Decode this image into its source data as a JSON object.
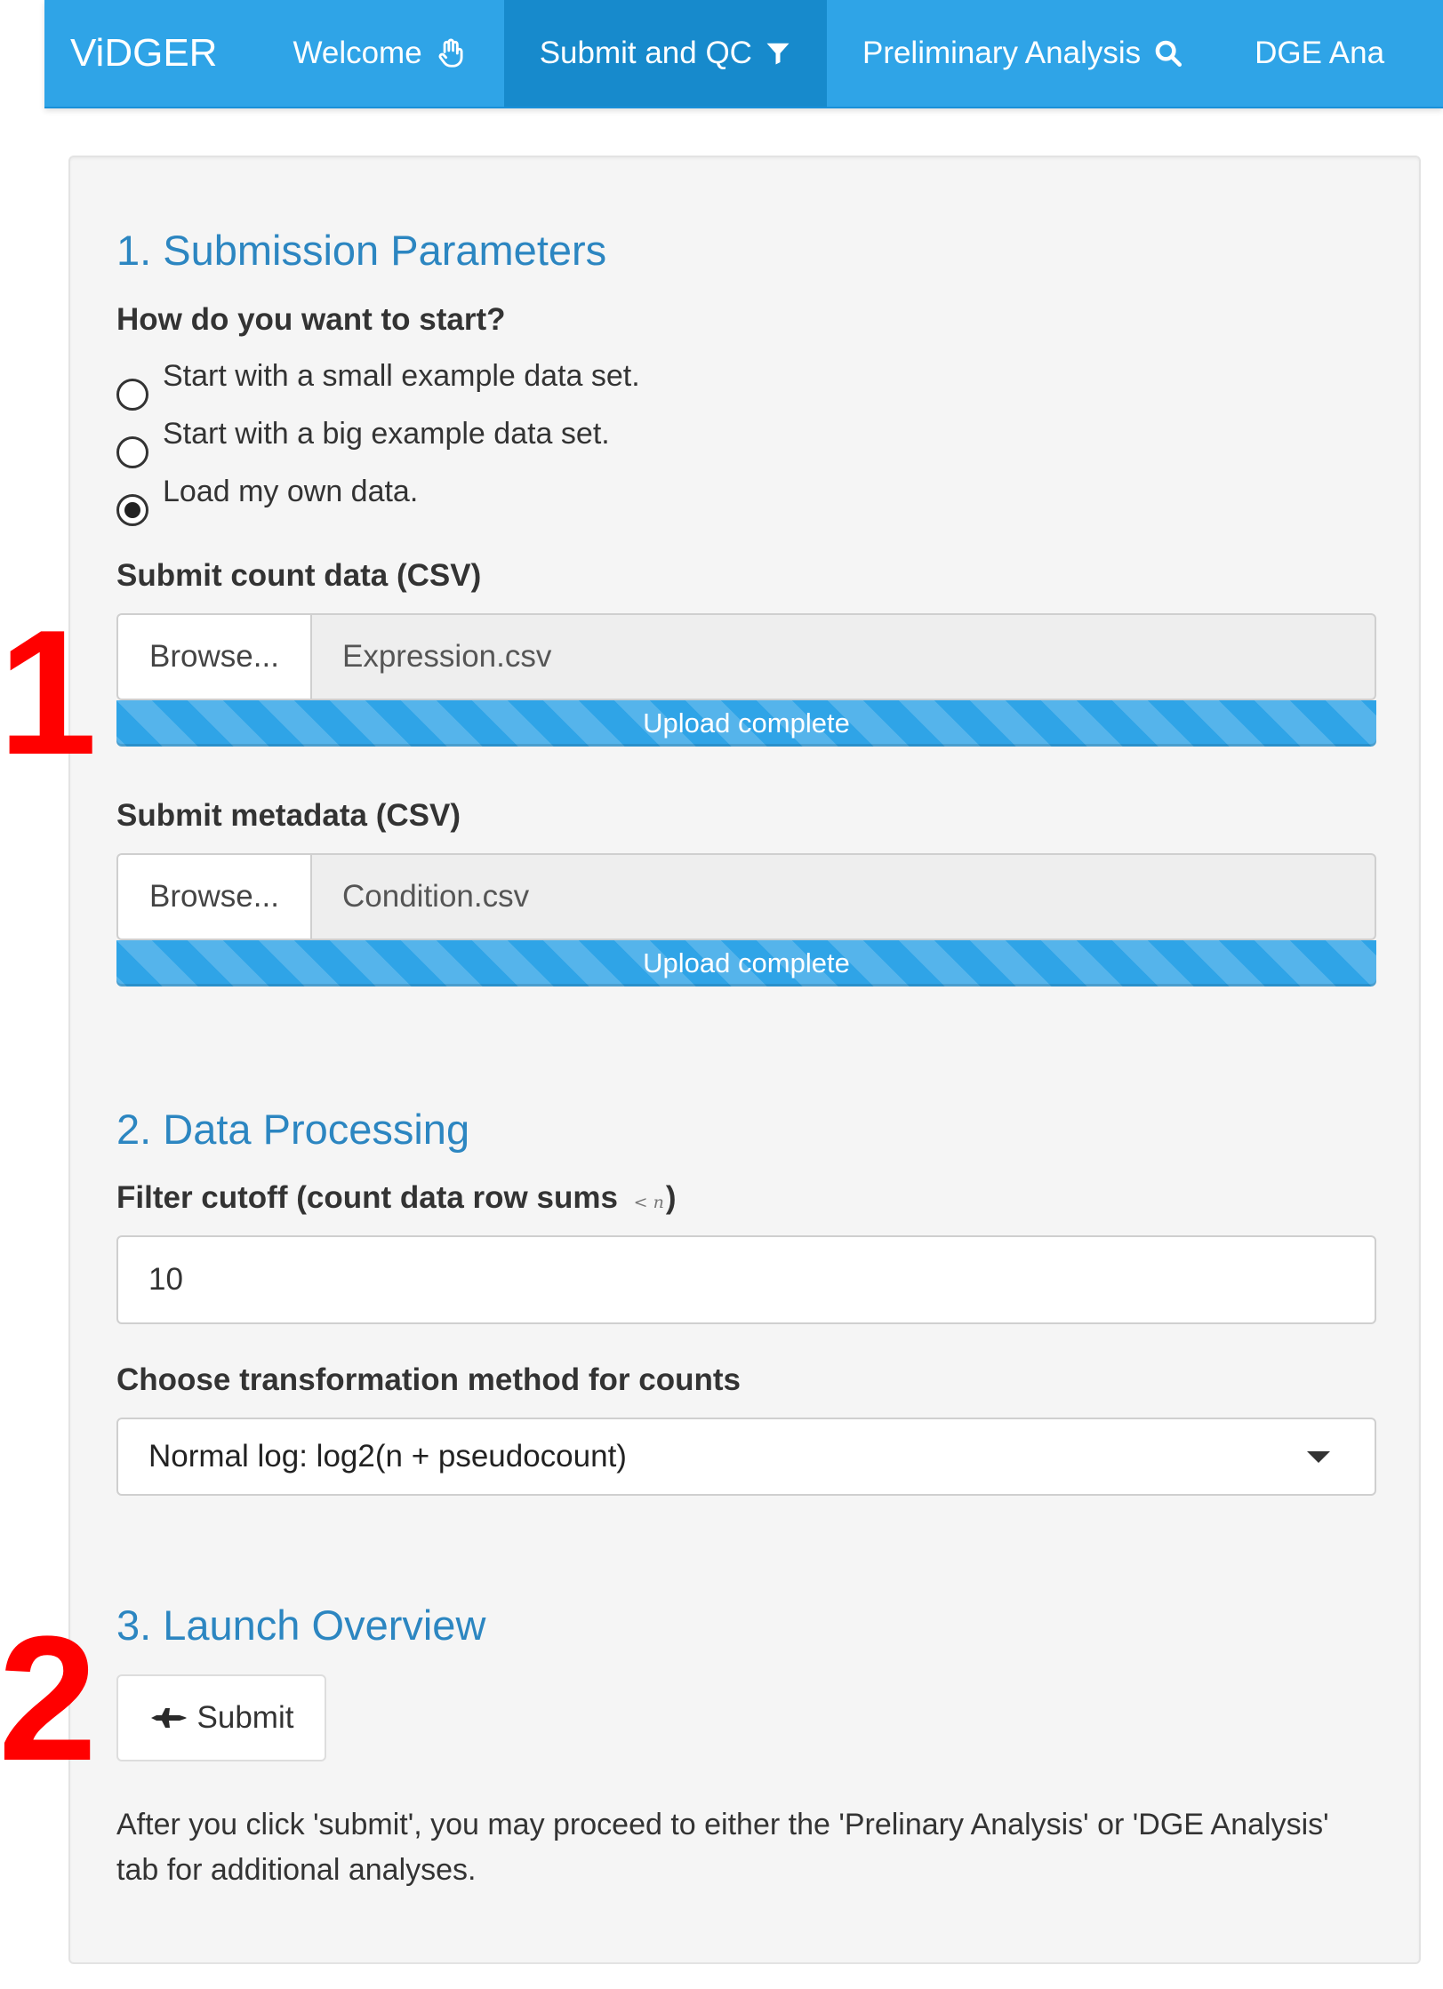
{
  "navbar": {
    "brand": "ViDGER",
    "tabs": [
      {
        "label": "Welcome",
        "icon": "hand-wave-icon",
        "active": false
      },
      {
        "label": "Submit and QC",
        "icon": "filter-icon",
        "active": true
      },
      {
        "label": "Preliminary Analysis",
        "icon": "search-icon",
        "active": false
      },
      {
        "label": "DGE Ana",
        "icon": "",
        "active": false
      }
    ]
  },
  "section1": {
    "title": "1. Submission Parameters",
    "start_label": "How do you want to start?",
    "options": [
      {
        "label": "Start with a small example data set.",
        "checked": false
      },
      {
        "label": "Start with a big example data set.",
        "checked": false
      },
      {
        "label": "Load my own data.",
        "checked": true
      }
    ],
    "count_data": {
      "label": "Submit count data (CSV)",
      "browse": "Browse...",
      "filename": "Expression.csv",
      "progress_text": "Upload complete",
      "progress_percent": 100
    },
    "metadata": {
      "label": "Submit metadata (CSV)",
      "browse": "Browse...",
      "filename": "Condition.csv",
      "progress_text": "Upload complete",
      "progress_percent": 100
    }
  },
  "section2": {
    "title": "2. Data Processing",
    "filter_label": "Filter cutoff (count data row sums",
    "filter_math": "< n",
    "filter_close": ")",
    "filter_value": "10",
    "transform_label": "Choose transformation method for counts",
    "transform_selected": "Normal log: log2(n + pseudocount)"
  },
  "section3": {
    "title": "3. Launch Overview",
    "submit_label": "Submit",
    "helper": "After you click 'submit', you may proceed to either the 'Prelinary Analysis' or 'DGE Analysis' tab for additional analyses."
  },
  "annotations": {
    "one": "1",
    "two": "2"
  },
  "colors": {
    "navbar": "#2fa4e7",
    "navbar_active": "#178acc",
    "section_title": "#2c86c1",
    "annotation": "#ff0000"
  }
}
